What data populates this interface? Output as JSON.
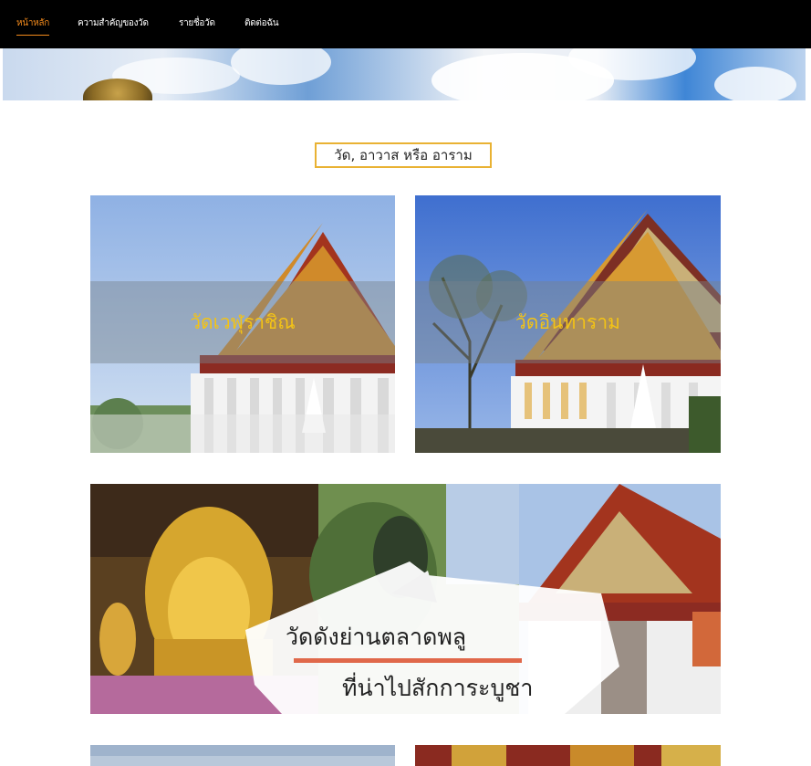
{
  "nav": {
    "items": [
      {
        "label": "หน้าหลัก",
        "active": true
      },
      {
        "label": "ความสำคัญของวัด",
        "active": false
      },
      {
        "label": "รายชื่อวัด",
        "active": false
      },
      {
        "label": "ติดต่อฉัน",
        "active": false
      }
    ]
  },
  "section": {
    "title": "วัด, อาวาส หรือ อาราม"
  },
  "cards": [
    {
      "title": "วัดเวฬุราชิณ"
    },
    {
      "title": "วัดอินทาราม"
    }
  ],
  "banner": {
    "line1": "วัดดังย่านตลาดพลู",
    "line2": "ที่น่าไปสักการะบูชา"
  },
  "colors": {
    "accent": "#f28a1c",
    "title_border": "#e9b233",
    "card_title": "#f3c316",
    "banner_rule": "#e0684a"
  }
}
